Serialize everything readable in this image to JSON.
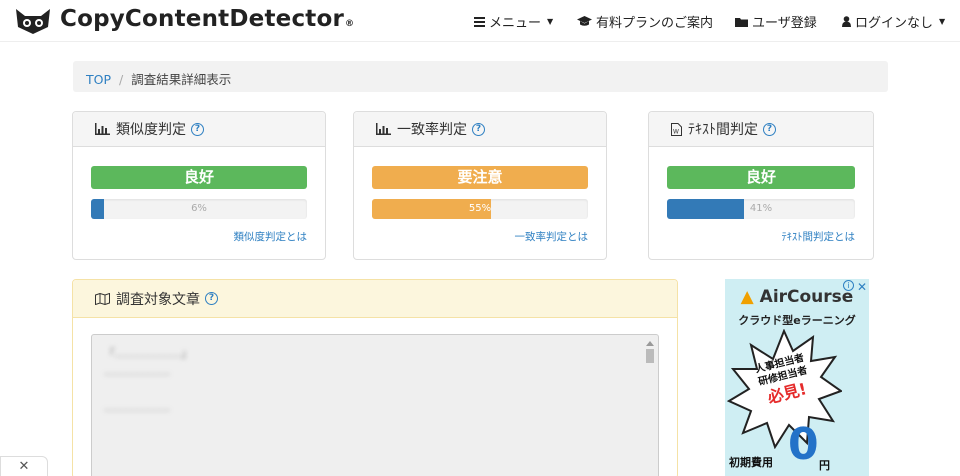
{
  "brand": {
    "name": "CopyContentDetector",
    "reg_mark": "®"
  },
  "nav": {
    "menu_label": "メニュー",
    "plans_label": "有料プランのご案内",
    "register_label": "ユーザ登録",
    "login_label": "ログインなし"
  },
  "breadcrumb": {
    "home": "TOP",
    "current": "調査結果詳細表示"
  },
  "panels": [
    {
      "title": "類似度判定",
      "verdict": "良好",
      "status": "good",
      "percent_label": "6%",
      "percent": 6,
      "fill_color": "#337ab7",
      "link": "類似度判定とは"
    },
    {
      "title": "一致率判定",
      "verdict": "要注意",
      "status": "warn",
      "percent_label": "55%",
      "percent": 55,
      "fill_color": "#f0ad4e",
      "link": "一致率判定とは"
    },
    {
      "title": "ﾃｷｽﾄ間判定",
      "verdict": "良好",
      "status": "good",
      "percent_label": "41%",
      "percent": 41,
      "fill_color": "#337ab7",
      "link": "ﾃｷｽﾄ間判定とは"
    }
  ],
  "target": {
    "title": "調査対象文章",
    "text": "「………………」\n………………\n\n………………"
  },
  "ad": {
    "brand": "AirCourse",
    "subtitle": "クラウド型eラーニング",
    "burst_line1": "人事担当者",
    "burst_line2": "研修担当者",
    "burst_big": "必見!",
    "cost_label": "初期費用",
    "cost_value": "0",
    "cost_unit": "円"
  },
  "colors": {
    "link": "#2f80c2",
    "good": "#5cb85c",
    "warn": "#f0ad4e",
    "bar_blue": "#337ab7"
  },
  "icons": [
    "logo-cat-icon",
    "list-icon",
    "graduation-cap-icon",
    "folder-icon",
    "user-icon",
    "bar-chart-icon",
    "doc-icon",
    "map-icon",
    "help-icon",
    "close-icon",
    "info-icon"
  ]
}
